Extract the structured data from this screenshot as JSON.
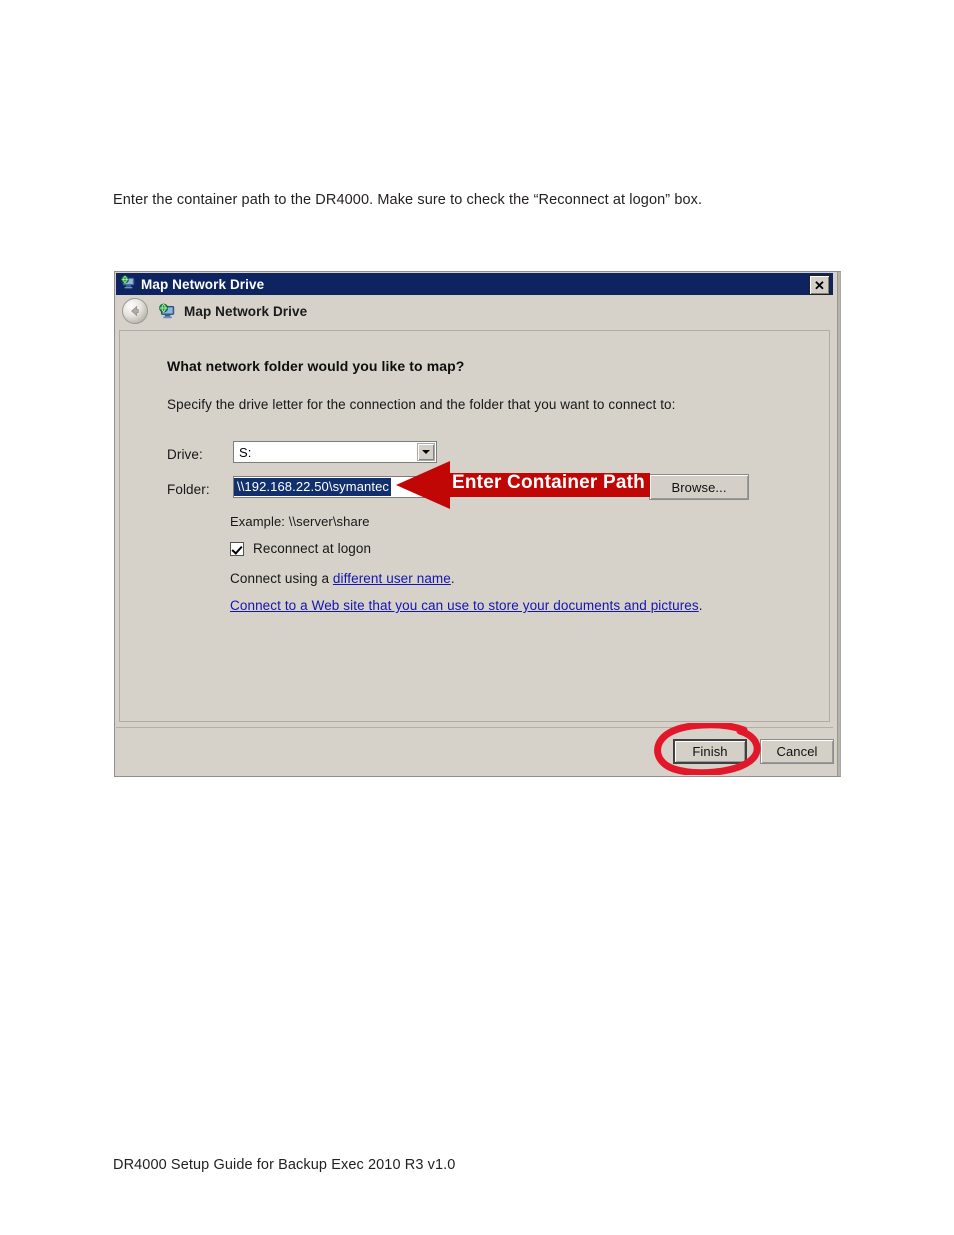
{
  "document": {
    "intro": "Enter the container path to the DR4000. Make sure to check the “Reconnect at logon” box.",
    "footer": "DR4000 Setup Guide for Backup Exec 2010 R3 v1.0"
  },
  "dialog": {
    "titlebar": {
      "title": "Map Network Drive",
      "icon": "network-drive-icon",
      "close_label": "✕"
    },
    "header": {
      "back_icon": "back-arrow-icon",
      "icon": "network-drive-icon",
      "title": "Map Network Drive"
    },
    "body": {
      "question": "What network folder would you like to map?",
      "subtitle": "Specify the drive letter for the connection and the folder that you want to connect to:",
      "drive_label": "Drive:",
      "drive_value": "S:",
      "folder_label": "Folder:",
      "folder_value": "\\\\192.168.22.50\\symantec",
      "browse_label": "Browse...",
      "example": "Example: \\\\server\\share",
      "reconnect_label": "Reconnect at logon",
      "reconnect_checked": true,
      "connect_prefix": "Connect using a ",
      "connect_link": "different user name",
      "connect_suffix": ".",
      "website_link": "Connect to a Web site that you can use to store your documents and pictures",
      "website_suffix": "."
    },
    "buttons": {
      "finish": "Finish",
      "cancel": "Cancel"
    }
  },
  "annotations": {
    "arrow_text": "Enter Container Path",
    "arrow_color": "#c10606",
    "ellipse_color": "#e2182a",
    "ellipse_target": "finish-button"
  },
  "colors": {
    "titlebar": "#0e2461",
    "dialog_face": "#d6d2ca",
    "selection": "#13306e",
    "link": "#1414b0"
  }
}
